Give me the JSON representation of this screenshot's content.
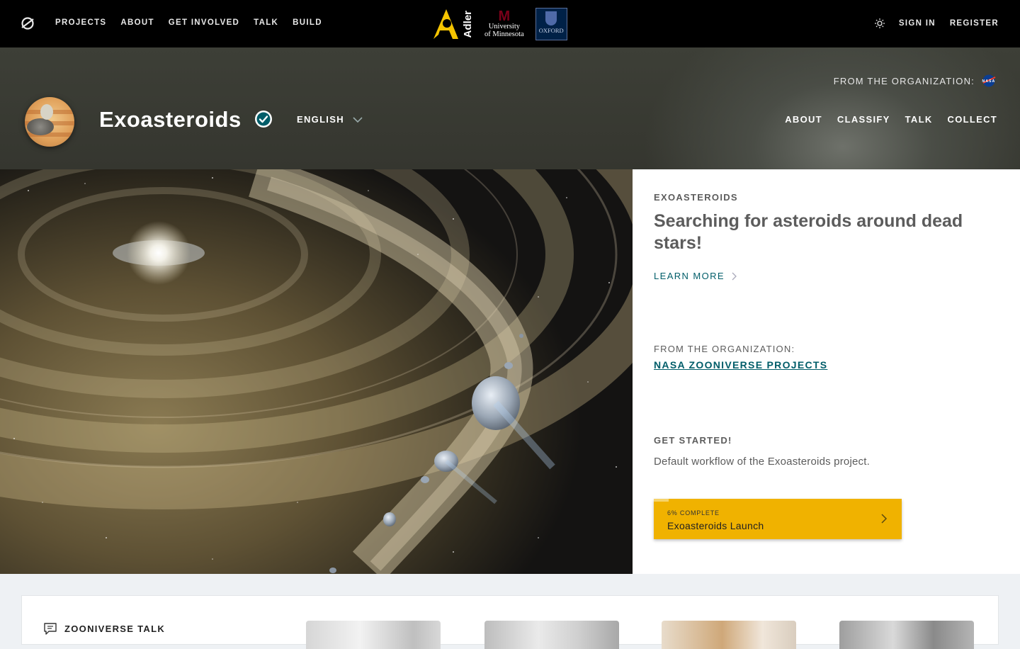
{
  "topnav": {
    "links": [
      "PROJECTS",
      "ABOUT",
      "GET INVOLVED",
      "TALK",
      "BUILD"
    ],
    "partners": {
      "adler": "Adler",
      "umn_line1": "University",
      "umn_line2": "of Minnesota",
      "oxford": "OXFORD"
    },
    "sign_in": "SIGN IN",
    "register": "REGISTER"
  },
  "project": {
    "title": "Exoasteroids",
    "language": "ENGLISH",
    "org_label": "FROM THE ORGANIZATION:",
    "nav": [
      "ABOUT",
      "CLASSIFY",
      "TALK",
      "COLLECT"
    ]
  },
  "side": {
    "eyebrow": "EXOASTEROIDS",
    "description": "Searching for asteroids around dead stars!",
    "learn_more": "LEARN MORE",
    "org_label": "FROM THE ORGANIZATION:",
    "org_name": "NASA ZOONIVERSE PROJECTS",
    "get_started": "GET STARTED!",
    "workflow_desc": "Default workflow of the Exoasteroids project.",
    "workflow": {
      "progress_label": "6% COMPLETE",
      "progress": 0.06,
      "name": "Exoasteroids Launch"
    }
  },
  "talk": {
    "heading": "ZOONIVERSE TALK"
  },
  "colors": {
    "accent_teal": "#005d69",
    "workflow_yellow": "#f0b200",
    "header_bg": "#3d3f37"
  },
  "icons": [
    "zooniverse-logo-icon",
    "sun-icon",
    "verified-check-icon",
    "chevron-down-icon",
    "nasa-logo-icon",
    "chevron-right-icon",
    "chat-bubble-icon"
  ]
}
